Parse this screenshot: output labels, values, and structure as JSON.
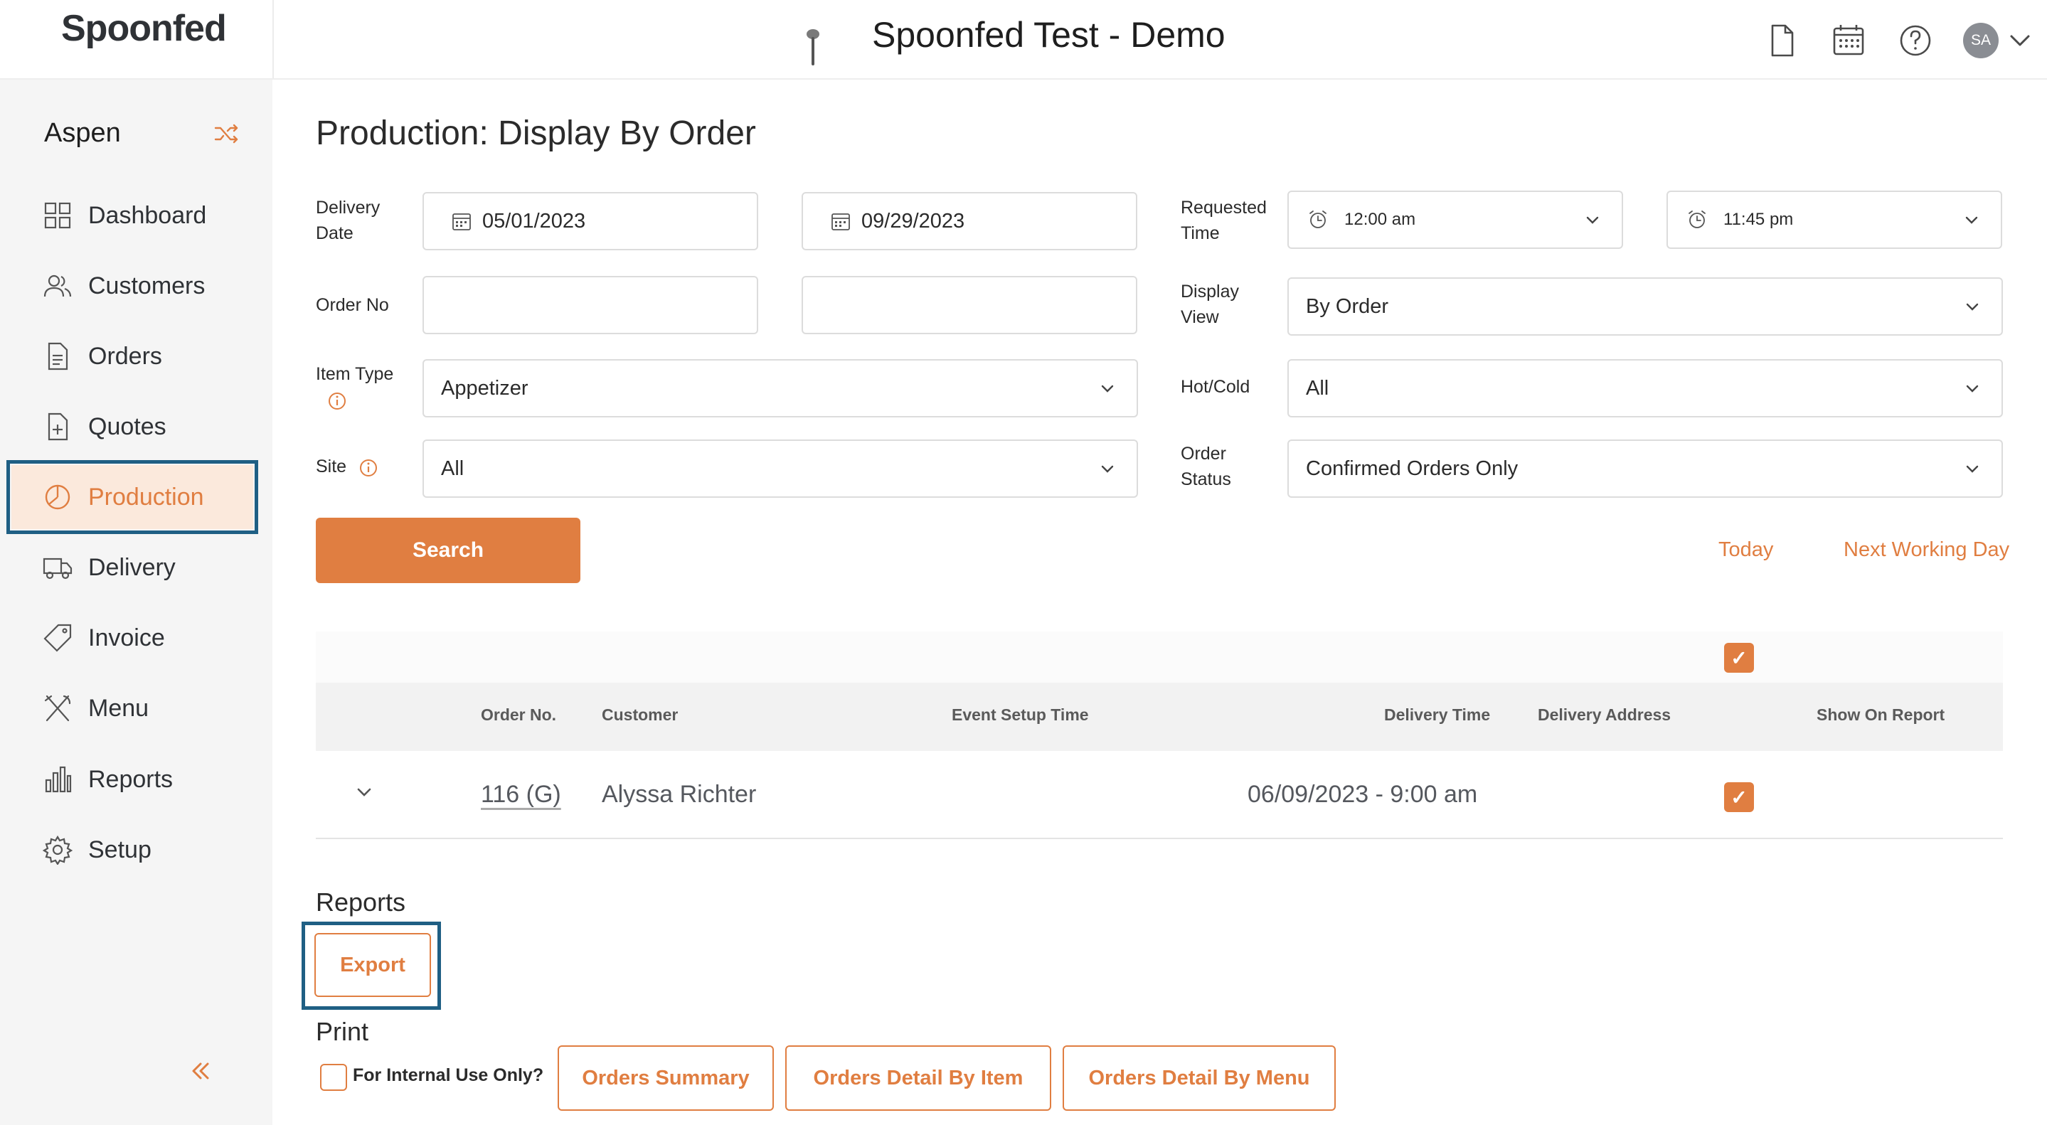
{
  "header": {
    "logo": "Spoonfed",
    "title": "Spoonfed Test - Demo",
    "avatar_initials": "SA",
    "icons": [
      "document-icon",
      "calendar-icon",
      "help-icon",
      "chevron-down-icon"
    ]
  },
  "sidebar": {
    "site_name": "Aspen",
    "items": [
      {
        "label": "Dashboard",
        "icon": "grid-icon"
      },
      {
        "label": "Customers",
        "icon": "users-icon"
      },
      {
        "label": "Orders",
        "icon": "document-icon"
      },
      {
        "label": "Quotes",
        "icon": "quote-document-icon"
      },
      {
        "label": "Production",
        "icon": "pie-chart-icon",
        "active": true
      },
      {
        "label": "Delivery",
        "icon": "truck-icon"
      },
      {
        "label": "Invoice",
        "icon": "tag-icon"
      },
      {
        "label": "Menu",
        "icon": "utensils-icon"
      },
      {
        "label": "Reports",
        "icon": "bar-chart-icon"
      },
      {
        "label": "Setup",
        "icon": "gear-icon"
      }
    ]
  },
  "page": {
    "title": "Production: Display By Order"
  },
  "filters": {
    "delivery_date_label": "Delivery\nDate",
    "delivery_date_from": "05/01/2023",
    "delivery_date_to": "09/29/2023",
    "requested_time_label": "Requested\nTime",
    "requested_time_from": "12:00 am",
    "requested_time_to": "11:45 pm",
    "order_no_label": "Order No",
    "order_no_from": "",
    "order_no_to": "",
    "display_view_label": "Display\nView",
    "display_view": "By Order",
    "item_type_label": "Item Type",
    "item_type": "Appetizer",
    "hot_cold_label": "Hot/Cold",
    "hot_cold": "All",
    "site_label": "Site",
    "site": "All",
    "order_status_label": "Order\nStatus",
    "order_status": "Confirmed Orders Only",
    "search_label": "Search",
    "today_label": "Today",
    "next_working_day_label": "Next Working Day"
  },
  "table": {
    "columns": [
      "Order No.",
      "Customer",
      "Event Setup Time",
      "Delivery Time",
      "Delivery Address",
      "Show On Report"
    ],
    "select_all_checked": true,
    "rows": [
      {
        "order_no": "116 (G)",
        "customer": "Alyssa Richter",
        "event_setup_time": "",
        "delivery_time": "06/09/2023 - 9:00 am",
        "delivery_address": "",
        "show_on_report": true
      }
    ]
  },
  "reports": {
    "title": "Reports",
    "export_label": "Export",
    "print_title": "Print",
    "internal_use_label": "For Internal Use Only?",
    "internal_use_checked": false,
    "orders_summary_label": "Orders Summary",
    "orders_detail_by_item_label": "Orders Detail By Item",
    "orders_detail_by_menu_label": "Orders Detail By Menu"
  },
  "colors": {
    "accent": "#e07e41",
    "highlight_frame": "#1f5f84",
    "sidebar_bg": "#f5f5f5",
    "active_nav_bg": "#fbe9dc"
  }
}
